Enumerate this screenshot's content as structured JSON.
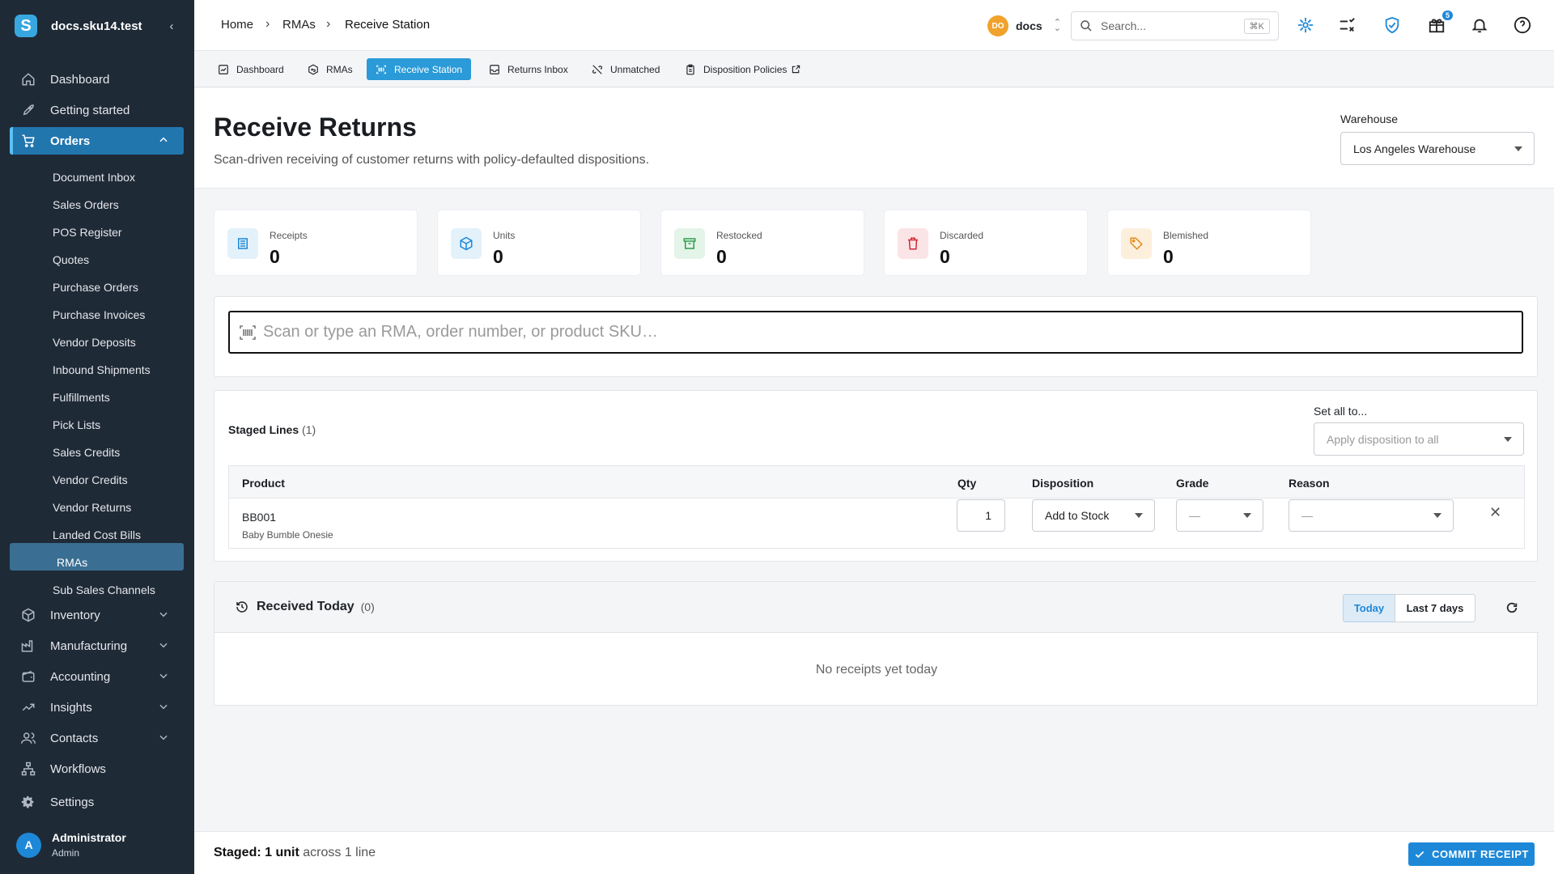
{
  "sidebar": {
    "org_name": "docs.sku14.test",
    "logo_letter": "S",
    "nav": {
      "dashboard": "Dashboard",
      "getting_started": "Getting started",
      "orders": "Orders",
      "inventory": "Inventory",
      "manufacturing": "Manufacturing",
      "accounting": "Accounting",
      "insights": "Insights",
      "contacts": "Contacts",
      "workflows": "Workflows",
      "settings": "Settings"
    },
    "order_items": [
      "Document Inbox",
      "Sales Orders",
      "POS Register",
      "Quotes",
      "Purchase Orders",
      "Purchase Invoices",
      "Vendor Deposits",
      "Inbound Shipments",
      "Fulfillments",
      "Pick Lists",
      "Sales Credits",
      "Vendor Credits",
      "Vendor Returns",
      "Landed Cost Bills",
      "RMAs",
      "Sub Sales Channels"
    ],
    "user": {
      "initial": "A",
      "name": "Administrator",
      "role": "Admin"
    }
  },
  "topbar": {
    "breadcrumb": [
      "Home",
      "RMAs",
      "Receive Station"
    ],
    "account": {
      "initials": "DO",
      "name": "docs"
    },
    "search": {
      "placeholder": "Search...",
      "shortcut": "⌘K"
    },
    "gift_badge": "5"
  },
  "tabs": [
    "Dashboard",
    "RMAs",
    "Receive Station",
    "Returns Inbox",
    "Unmatched",
    "Disposition Policies"
  ],
  "active_tab": "Receive Station",
  "page": {
    "title": "Receive Returns",
    "subtitle": "Scan-driven receiving of customer returns with policy-defaulted dispositions.",
    "warehouse_label": "Warehouse",
    "warehouse_value": "Los Angeles Warehouse"
  },
  "stats": [
    {
      "label": "Receipts",
      "value": "0",
      "icon": "list-icon",
      "color": "#1e88d8",
      "bg": "#e3f1fb"
    },
    {
      "label": "Units",
      "value": "0",
      "icon": "cube-icon",
      "color": "#1e88d8",
      "bg": "#e3f1fb"
    },
    {
      "label": "Restocked",
      "value": "0",
      "icon": "archive-icon",
      "color": "#2e9b4e",
      "bg": "#e4f4e8"
    },
    {
      "label": "Discarded",
      "value": "0",
      "icon": "trash-icon",
      "color": "#d0293a",
      "bg": "#fbe4e6"
    },
    {
      "label": "Blemished",
      "value": "0",
      "icon": "tag-icon",
      "color": "#e08a1c",
      "bg": "#fcefdc"
    }
  ],
  "scan": {
    "placeholder": "Scan or type an RMA, order number, or product SKU…"
  },
  "staged": {
    "title": "Staged Lines",
    "count": "(1)",
    "set_all_label": "Set all to...",
    "set_all_placeholder": "Apply disposition to all",
    "columns": {
      "product": "Product",
      "qty": "Qty",
      "disposition": "Disposition",
      "grade": "Grade",
      "reason": "Reason"
    },
    "rows": [
      {
        "sku": "BB001",
        "name": "Baby Bumble Onesie",
        "qty": "1",
        "disposition": "Add to Stock",
        "grade": "—",
        "reason": "—"
      }
    ]
  },
  "received": {
    "title": "Received Today",
    "count": "(0)",
    "range_today": "Today",
    "range_week": "Last 7 days",
    "empty": "No receipts yet today"
  },
  "footer": {
    "prefix": "Staged:",
    "units": "1 unit",
    "suffix": "across 1 line",
    "commit_label": "COMMIT RECEIPT"
  }
}
